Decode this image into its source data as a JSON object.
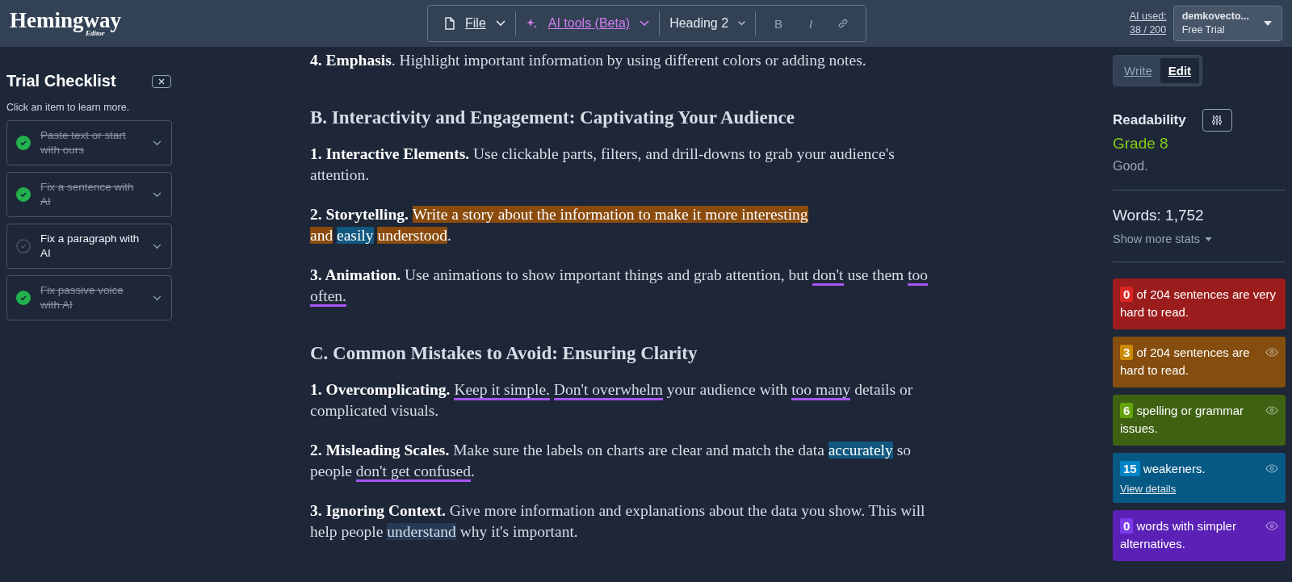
{
  "header": {
    "logo": "Hemingway",
    "logo_sub": "Editor",
    "toolbar": [
      {
        "kind": "menu",
        "label": "File"
      },
      {
        "kind": "ai",
        "label": "AI tools (Beta)"
      },
      {
        "kind": "dropdown",
        "label": "Heading 2"
      },
      {
        "kind": "bold",
        "label": "B"
      },
      {
        "kind": "italic",
        "label": "I"
      },
      {
        "kind": "link"
      }
    ],
    "ai_used_label": "AI used:",
    "ai_used_count": "38 / 200",
    "account": {
      "name": "demkovecto...",
      "plan": "Free Trial"
    }
  },
  "checklist": {
    "title": "Trial Checklist",
    "hint": "Click an item to learn more.",
    "items": [
      {
        "label": "Paste text or start with ours",
        "checked": true
      },
      {
        "label": "Fix a sentence with AI",
        "checked": true
      },
      {
        "label": "Fix a paragraph with AI",
        "checked": false
      },
      {
        "label": "Fix passive voice with AI",
        "checked": true
      }
    ]
  },
  "document": [
    {
      "kind": "paragraph",
      "segments": [
        {
          "text": "4. Emphasis",
          "kind": "bold"
        },
        {
          "text": ". Highlight important information by using different colors or adding notes.",
          "kind": "plain"
        }
      ]
    },
    {
      "kind": "heading",
      "segments": [
        {
          "text": "B. Interactivity and Engagement: Captivating Your Audience",
          "kind": "plain"
        }
      ]
    },
    {
      "kind": "paragraph",
      "segments": [
        {
          "text": "1. Interactive Elements.",
          "kind": "bold"
        },
        {
          "text": " Use clickable parts, filters, and drill-downs to grab your audience's attention.",
          "kind": "plain"
        }
      ]
    },
    {
      "kind": "paragraph",
      "segments": [
        {
          "text": "2. Storytelling.",
          "kind": "bold"
        },
        {
          "text": "Write a story about the information to make it more interesting and",
          "kind": "hard"
        },
        {
          "text": "easily",
          "kind": "weakener"
        },
        {
          "text": "understood",
          "kind": "hard"
        },
        {
          "text": ".",
          "kind": "plain"
        }
      ]
    },
    {
      "kind": "paragraph",
      "segments": [
        {
          "text": "3. Animation.",
          "kind": "bold"
        },
        {
          "text": " Use animations to show important things and grab attention, but ",
          "kind": "plain"
        },
        {
          "text": "don't",
          "kind": "simpler"
        },
        {
          "text": " use them ",
          "kind": "plain"
        },
        {
          "text": "too often.",
          "kind": "simpler"
        }
      ]
    },
    {
      "kind": "heading",
      "segments": [
        {
          "text": "C. Common Mistakes to Avoid: Ensuring Clarity",
          "kind": "plain"
        }
      ]
    },
    {
      "kind": "paragraph",
      "segments": [
        {
          "text": "1. Overcomplicating.",
          "kind": "bold"
        },
        {
          "text": "Keep it simple.",
          "kind": "simpler"
        },
        {
          "text": "Don't overwhelm",
          "kind": "simpler"
        },
        {
          "text": " your audience with ",
          "kind": "plain"
        },
        {
          "text": "too many",
          "kind": "simpler"
        },
        {
          "text": " details or complicated visuals.",
          "kind": "plain"
        }
      ]
    },
    {
      "kind": "paragraph",
      "segments": [
        {
          "text": "2. Misleading Scales.",
          "kind": "bold"
        },
        {
          "text": " Make sure the labels on charts are clear and match the data ",
          "kind": "plain"
        },
        {
          "text": "accurately",
          "kind": "weakener"
        },
        {
          "text": " so people ",
          "kind": "plain"
        },
        {
          "text": "don't get confused",
          "kind": "simpler"
        },
        {
          "text": ".",
          "kind": "plain"
        }
      ]
    },
    {
      "kind": "paragraph",
      "segments": [
        {
          "text": "3. Ignoring Context.",
          "kind": "bold"
        },
        {
          "text": " Give more information and explanations about the data you show. This will help people ",
          "kind": "plain"
        },
        {
          "text": "understand",
          "kind": "selected"
        },
        {
          "text": " why it's important.",
          "kind": "plain"
        }
      ]
    }
  ],
  "mode_tabs": [
    {
      "label": "Write",
      "selected": false
    },
    {
      "label": "Edit",
      "selected": true
    }
  ],
  "readability": {
    "title": "Readability",
    "grade": "Grade 8",
    "verdict": "Good."
  },
  "words": "Words: 1,752",
  "more_stats": "Show more stats",
  "cards": [
    {
      "kind": "very-hard",
      "count": "0",
      "text": "of 204 sentences are very hard to read.",
      "eye": false
    },
    {
      "kind": "hard",
      "count": "3",
      "text": "of 204 sentences are hard to read.",
      "eye": true
    },
    {
      "kind": "grammar",
      "count": "6",
      "text": "spelling or grammar issues.",
      "eye": true
    },
    {
      "kind": "weakener",
      "count": "15",
      "text": "weakeners.",
      "link": "View details",
      "eye": true
    },
    {
      "kind": "simpler",
      "count": "0",
      "text": "words with simpler alternatives.",
      "eye": true
    }
  ]
}
